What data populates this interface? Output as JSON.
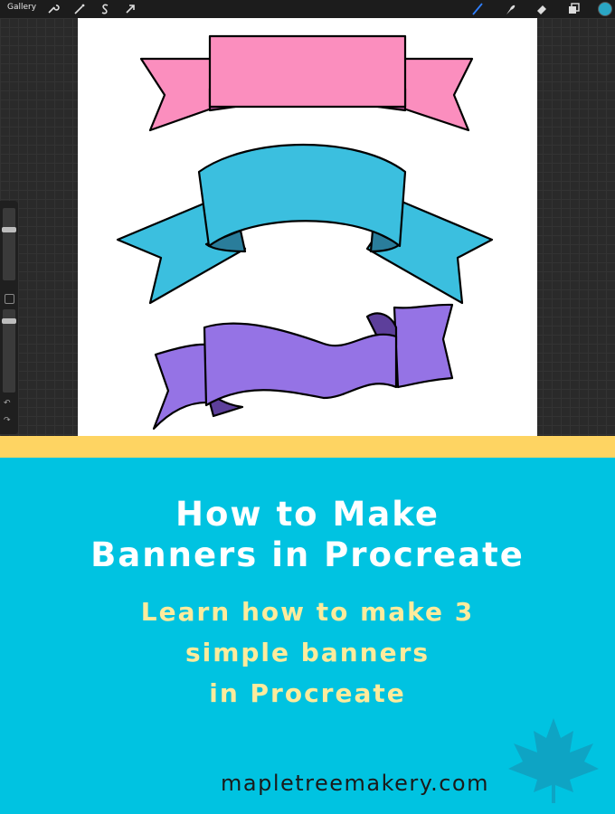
{
  "app": {
    "gallery_label": "Gallery",
    "toolbar_left_icons": [
      "wrench-icon",
      "magic-wand-icon",
      "selection-s-icon",
      "transform-arrow-icon"
    ],
    "toolbar_right_icons": [
      "brush-icon",
      "smudge-icon",
      "eraser-icon",
      "layers-icon",
      "color-swatch-icon"
    ],
    "active_color": "#2aa6c4"
  },
  "banners": [
    {
      "name": "pink-banner",
      "fill": "#fb8ebe",
      "shade": "#b7579a"
    },
    {
      "name": "blue-banner",
      "fill": "#3bbfdf",
      "shade": "#2a7d9b"
    },
    {
      "name": "purple-banner",
      "fill": "#9573e5",
      "shade": "#5d3f9b"
    }
  ],
  "colors": {
    "yellow_strip": "#fed462",
    "panel_bg": "#00c3e1",
    "title_color": "#ffffff",
    "subtitle_color": "#fdeb9c"
  },
  "headline": {
    "line1": "How to Make",
    "line2": "Banners in Procreate"
  },
  "subheadline": {
    "line1": "Learn how to make 3",
    "line2": "simple banners",
    "line3": "in Procreate"
  },
  "website": "mapletreemakery.com"
}
